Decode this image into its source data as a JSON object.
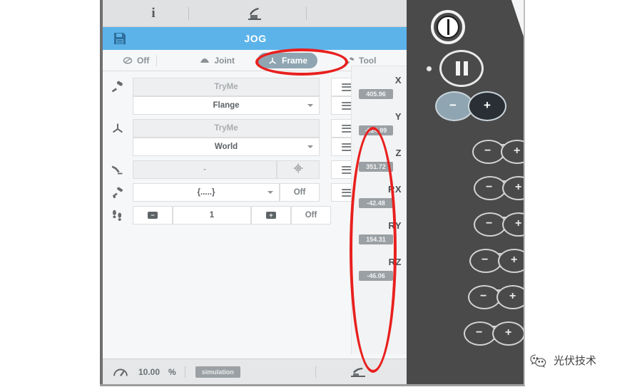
{
  "window": {
    "title": "JOG",
    "save_icon": "floppy-disk-icon"
  },
  "topbar": {
    "info_label": "i",
    "robot_icon": "robot-arm-icon"
  },
  "tabs": [
    {
      "id": "off",
      "label": "Off",
      "icon": "no-entry-icon",
      "selected": false
    },
    {
      "id": "joint",
      "label": "Joint",
      "icon": "joint-arc-icon",
      "selected": false
    },
    {
      "id": "frame",
      "label": "Frame",
      "icon": "frame-axes-icon",
      "selected": true
    },
    {
      "id": "tool",
      "label": "Tool",
      "icon": "tool-tip-icon",
      "selected": false
    }
  ],
  "form": {
    "teach_button_icon": "teach-robot-icon",
    "rows": [
      {
        "icon": "tool-gripper-icon",
        "fields": [
          {
            "value": "TryMe",
            "state": "readonly",
            "caret": false
          },
          {
            "value": "Flange",
            "state": "editable",
            "caret": true
          }
        ]
      },
      {
        "icon": "frame-axes-icon",
        "fields": [
          {
            "value": "TryMe",
            "state": "readonly",
            "caret": false
          },
          {
            "value": "World",
            "state": "editable",
            "caret": true
          }
        ]
      },
      {
        "icon": "robot-arm-icon",
        "fields": [
          {
            "value": "-",
            "state": "readonly",
            "caret": false
          }
        ],
        "crosshair_icon": "crosshair-target-icon"
      },
      {
        "icon": "tool-point-icon",
        "fields": [
          {
            "value": "{.....}",
            "state": "editable",
            "caret": true
          }
        ],
        "off_label": "Off"
      },
      {
        "icon": "footsteps-icon",
        "stepper": {
          "minus_label": "−",
          "value": "1",
          "plus_label": "+",
          "off_label": "Off"
        }
      }
    ],
    "list_icon": "hamburger-list-icon"
  },
  "coordinates": [
    {
      "axis": "X",
      "value": "405.96"
    },
    {
      "axis": "Y",
      "value": "-524.99"
    },
    {
      "axis": "Z",
      "value": "351.72"
    },
    {
      "axis": "RX",
      "value": "-42.48"
    },
    {
      "axis": "RY",
      "value": "154.31"
    },
    {
      "axis": "RZ",
      "value": "-46.06"
    }
  ],
  "jog_panel": {
    "power_icon": "power-button-icon",
    "pause_icon": "pause-button-icon",
    "speed_minus": "−",
    "speed_plus": "+",
    "jog_minus": "−",
    "jog_plus": "+"
  },
  "statusbar": {
    "gauge_icon": "speedometer-icon",
    "speed_value": "10.00",
    "percent_label": "%",
    "mode_badge": "simulation",
    "right_icon": "robot-arm-icon"
  },
  "annotations": {
    "frame_highlight": "red-ellipse-frame-tab",
    "coords_highlight": "red-ellipse-coordinates"
  },
  "watermark": {
    "text": "光伏技术",
    "icon": "wechat-icon"
  },
  "colors": {
    "title_blue": "#5cb3ea",
    "tab_selected": "#8fa6b2",
    "panel_dark": "#4a4a4a",
    "annotation_red": "#e8201e",
    "badge_grey": "#9aa0a4"
  }
}
